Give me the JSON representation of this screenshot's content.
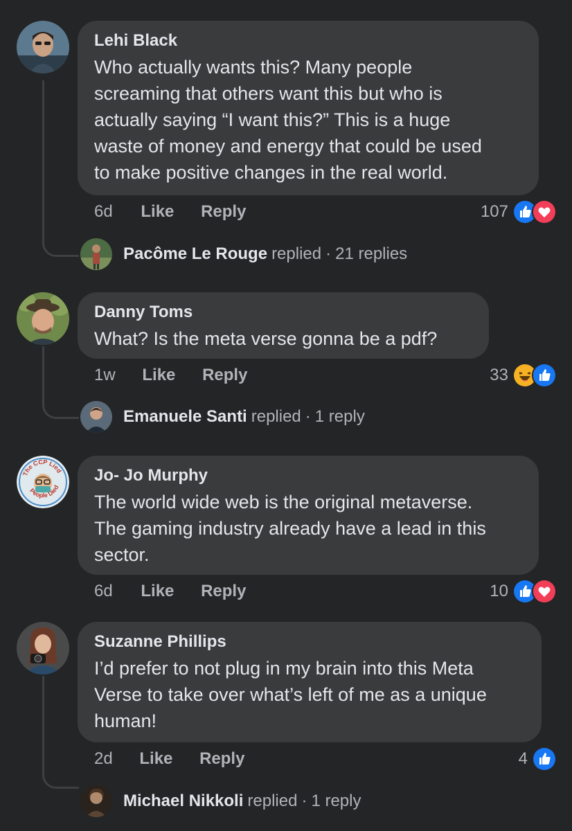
{
  "comments": [
    {
      "author": "Lehi Black",
      "lines": [
        "Who actually wants this? Many people",
        "screaming that others want this but who is",
        "actually saying “I want this?” This is a huge",
        "waste of money and energy that could be used",
        "to make positive changes in the real world."
      ],
      "time": "6d",
      "like_label": "Like",
      "reply_label": "Reply",
      "reaction_count": "107",
      "reactions": [
        "like-icon",
        "love-icon"
      ],
      "reply_thread": {
        "name": "Pacôme Le Rouge",
        "verb": "replied",
        "dot": "·",
        "count": "21 replies"
      }
    },
    {
      "author": "Danny Toms",
      "lines": [
        "What?  Is the meta verse gonna be a pdf?"
      ],
      "time": "1w",
      "like_label": "Like",
      "reply_label": "Reply",
      "reaction_count": "33",
      "reactions": [
        "haha-icon",
        "like-icon"
      ],
      "reply_thread": {
        "name": "Emanuele Santi",
        "verb": "replied",
        "dot": "·",
        "count": "1 reply"
      }
    },
    {
      "author": "Jo- Jo Murphy",
      "lines": [
        "The world wide web is the original metaverse.",
        "The gaming industry already have a lead in this",
        "sector."
      ],
      "time": "6d",
      "like_label": "Like",
      "reply_label": "Reply",
      "reaction_count": "10",
      "reactions": [
        "like-icon",
        "love-icon"
      ],
      "avatar_text": "The CCP Lied People Died"
    },
    {
      "author": "Suzanne Phillips",
      "lines": [
        "I’d prefer to not plug in my brain into this Meta",
        "Verse to take over what’s left of me as a unique",
        "human!"
      ],
      "time": "2d",
      "like_label": "Like",
      "reply_label": "Reply",
      "reaction_count": "4",
      "reactions": [
        "like-icon"
      ],
      "reply_thread": {
        "name": "Michael Nikkoli",
        "verb": "replied",
        "dot": "·",
        "count": "1 reply"
      }
    }
  ],
  "colors": {
    "background": "#242526",
    "bubble": "#3a3b3c",
    "text_primary": "#e4e6eb",
    "text_secondary": "#b0b3b8",
    "like_blue": "#1877f2",
    "love_red": "#f33e58",
    "haha_yellow": "#f7b125"
  }
}
